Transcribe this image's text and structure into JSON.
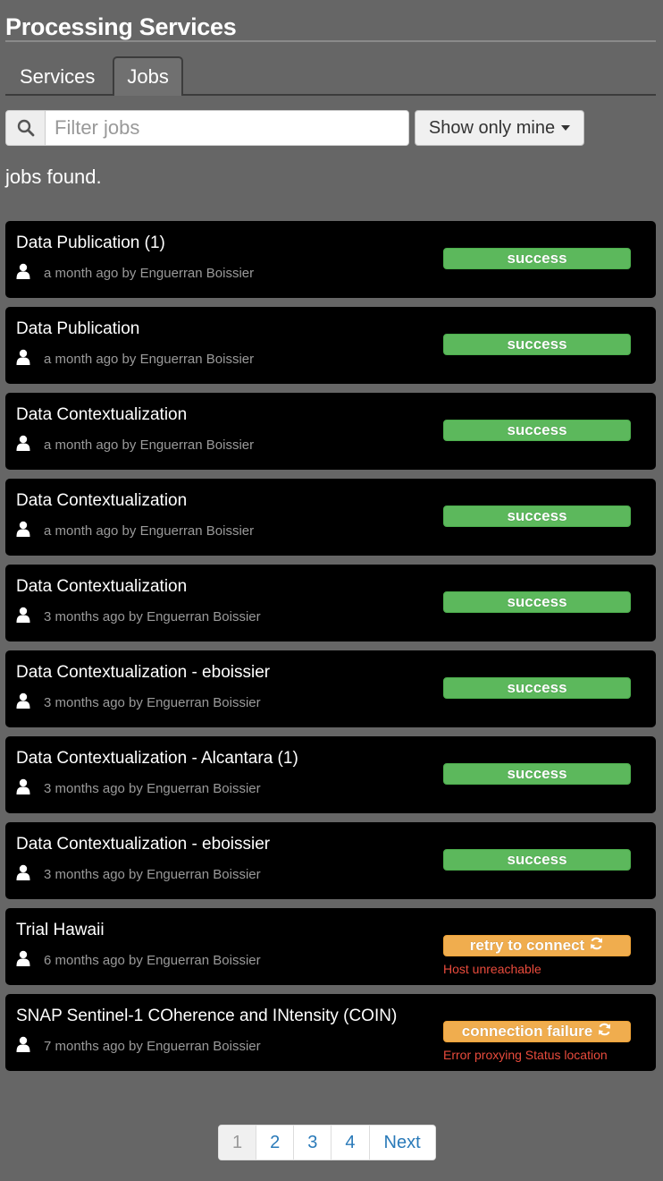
{
  "header": {
    "title": "Processing Services"
  },
  "tabs": [
    {
      "label": "Services",
      "active": false
    },
    {
      "label": "Jobs",
      "active": true
    }
  ],
  "search": {
    "placeholder": "Filter jobs",
    "value": ""
  },
  "filter_button": {
    "label": "Show only mine"
  },
  "jobs_found_text": "jobs found.",
  "jobs": [
    {
      "title": "Data Publication (1)",
      "meta": "a month ago by Enguerran Boissier",
      "status": "success"
    },
    {
      "title": "Data Publication",
      "meta": "a month ago by Enguerran Boissier",
      "status": "success"
    },
    {
      "title": "Data Contextualization",
      "meta": "a month ago by Enguerran Boissier",
      "status": "success"
    },
    {
      "title": "Data Contextualization",
      "meta": "a month ago by Enguerran Boissier",
      "status": "success"
    },
    {
      "title": "Data Contextualization",
      "meta": "3 months ago by Enguerran Boissier",
      "status": "success"
    },
    {
      "title": "Data Contextualization - eboissier",
      "meta": "3 months ago by Enguerran Boissier",
      "status": "success"
    },
    {
      "title": "Data Contextualization - Alcantara (1)",
      "meta": "3 months ago by Enguerran Boissier",
      "status": "success"
    },
    {
      "title": "Data Contextualization - eboissier",
      "meta": "3 months ago by Enguerran Boissier",
      "status": "success"
    },
    {
      "title": "Trial Hawaii",
      "meta": "6 months ago by Enguerran Boissier",
      "status": "retry to connect",
      "status_icon": "refresh-icon",
      "message": "Host unreachable"
    },
    {
      "title": "SNAP Sentinel-1 COherence and INtensity (COIN)",
      "meta": "7 months ago by Enguerran Boissier",
      "status": "connection failure",
      "status_icon": "refresh-icon",
      "message": "Error proxying Status location"
    }
  ],
  "pagination": {
    "pages": [
      "1",
      "2",
      "3",
      "4"
    ],
    "current": "1",
    "next_label": "Next"
  },
  "colors": {
    "background": "#666666",
    "card": "#000000",
    "success": "#5cb85c",
    "warning": "#f0ad4e",
    "error_text": "#e94b3c",
    "link": "#2a7ab9"
  }
}
